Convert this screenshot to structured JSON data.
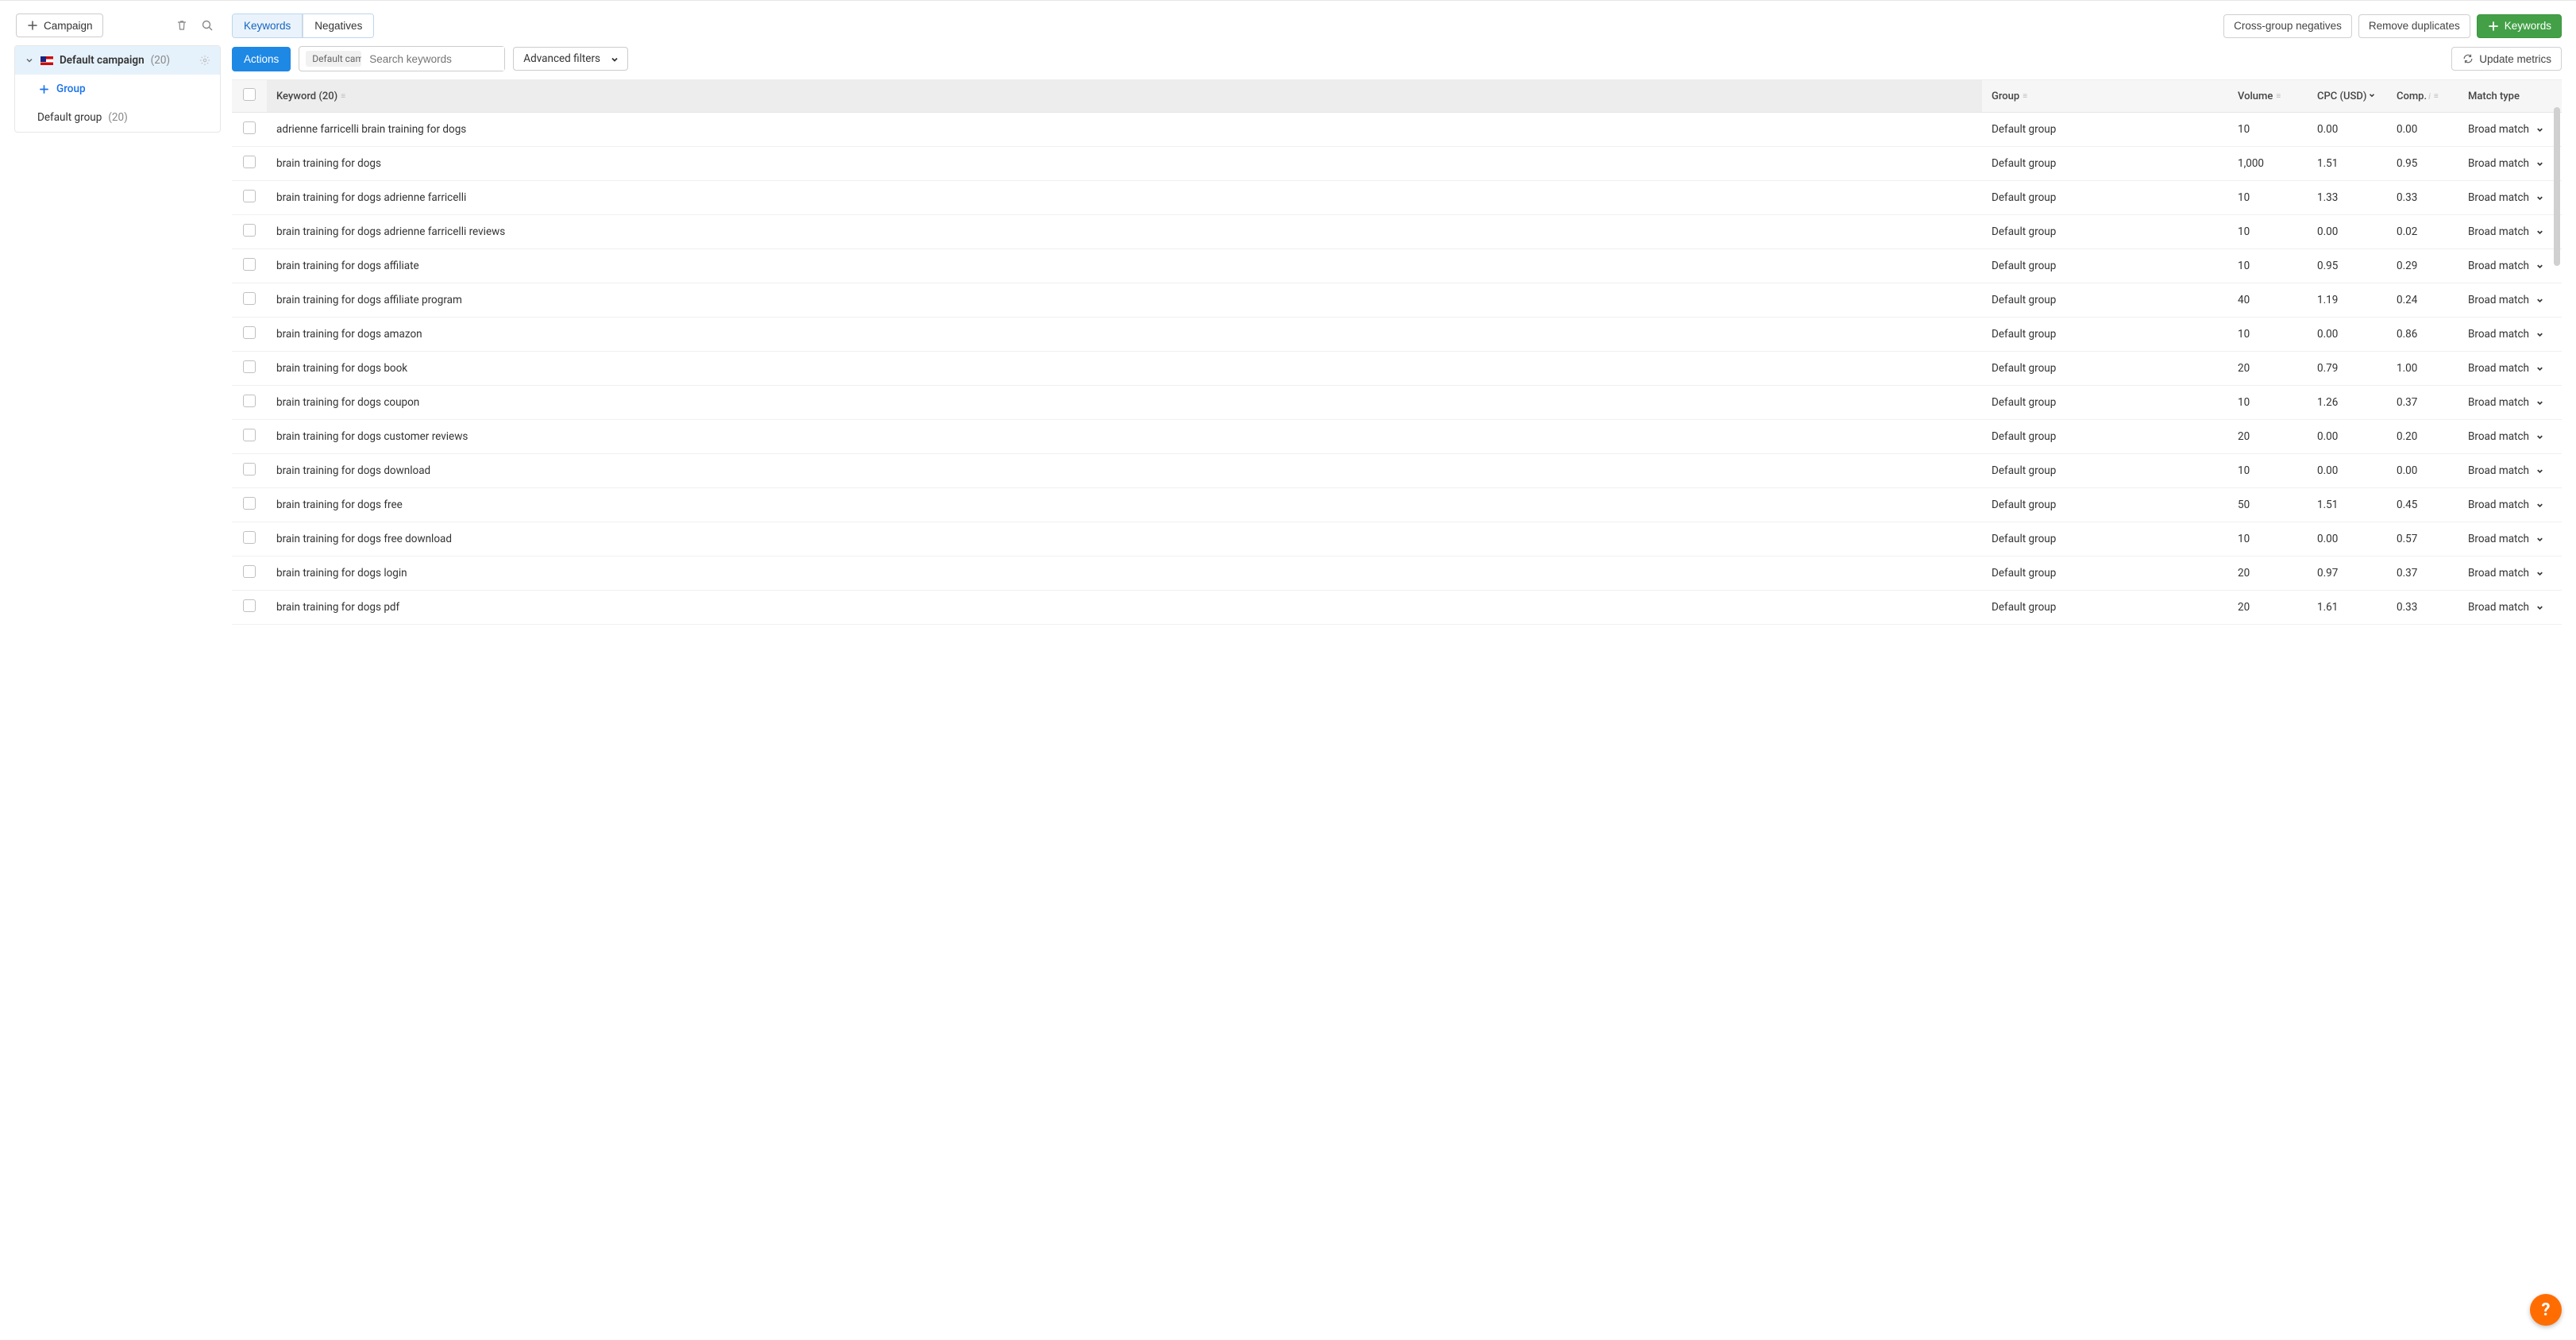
{
  "sidebar": {
    "campaign_btn": "Campaign",
    "campaign_name": "Default campaign",
    "campaign_count": "(20)",
    "add_group": "Group",
    "default_group": "Default group",
    "default_group_count": "(20)"
  },
  "tabs": {
    "keywords": "Keywords",
    "negatives": "Negatives"
  },
  "actions": {
    "cross_group_negatives": "Cross-group negatives",
    "remove_duplicates": "Remove duplicates",
    "add_keywords": "Keywords",
    "actions_btn": "Actions",
    "search_chip": "Default campa",
    "search_placeholder": "Search keywords",
    "advanced_filters": "Advanced filters",
    "update_metrics": "Update metrics"
  },
  "table": {
    "headers": {
      "keyword": "Keyword (20)",
      "group": "Group",
      "volume": "Volume",
      "cpc": "CPC (USD)",
      "comp": "Comp.",
      "match_type": "Match type"
    },
    "rows": [
      {
        "keyword": "adrienne farricelli brain training for dogs",
        "group": "Default group",
        "volume": "10",
        "cpc": "0.00",
        "comp": "0.00",
        "match": "Broad match"
      },
      {
        "keyword": "brain training for dogs",
        "group": "Default group",
        "volume": "1,000",
        "cpc": "1.51",
        "comp": "0.95",
        "match": "Broad match"
      },
      {
        "keyword": "brain training for dogs adrienne farricelli",
        "group": "Default group",
        "volume": "10",
        "cpc": "1.33",
        "comp": "0.33",
        "match": "Broad match"
      },
      {
        "keyword": "brain training for dogs adrienne farricelli reviews",
        "group": "Default group",
        "volume": "10",
        "cpc": "0.00",
        "comp": "0.02",
        "match": "Broad match"
      },
      {
        "keyword": "brain training for dogs affiliate",
        "group": "Default group",
        "volume": "10",
        "cpc": "0.95",
        "comp": "0.29",
        "match": "Broad match"
      },
      {
        "keyword": "brain training for dogs affiliate program",
        "group": "Default group",
        "volume": "40",
        "cpc": "1.19",
        "comp": "0.24",
        "match": "Broad match"
      },
      {
        "keyword": "brain training for dogs amazon",
        "group": "Default group",
        "volume": "10",
        "cpc": "0.00",
        "comp": "0.86",
        "match": "Broad match"
      },
      {
        "keyword": "brain training for dogs book",
        "group": "Default group",
        "volume": "20",
        "cpc": "0.79",
        "comp": "1.00",
        "match": "Broad match"
      },
      {
        "keyword": "brain training for dogs coupon",
        "group": "Default group",
        "volume": "10",
        "cpc": "1.26",
        "comp": "0.37",
        "match": "Broad match"
      },
      {
        "keyword": "brain training for dogs customer reviews",
        "group": "Default group",
        "volume": "20",
        "cpc": "0.00",
        "comp": "0.20",
        "match": "Broad match"
      },
      {
        "keyword": "brain training for dogs download",
        "group": "Default group",
        "volume": "10",
        "cpc": "0.00",
        "comp": "0.00",
        "match": "Broad match"
      },
      {
        "keyword": "brain training for dogs free",
        "group": "Default group",
        "volume": "50",
        "cpc": "1.51",
        "comp": "0.45",
        "match": "Broad match"
      },
      {
        "keyword": "brain training for dogs free download",
        "group": "Default group",
        "volume": "10",
        "cpc": "0.00",
        "comp": "0.57",
        "match": "Broad match"
      },
      {
        "keyword": "brain training for dogs login",
        "group": "Default group",
        "volume": "20",
        "cpc": "0.97",
        "comp": "0.37",
        "match": "Broad match"
      },
      {
        "keyword": "brain training for dogs pdf",
        "group": "Default group",
        "volume": "20",
        "cpc": "1.61",
        "comp": "0.33",
        "match": "Broad match"
      }
    ]
  },
  "help": "?"
}
